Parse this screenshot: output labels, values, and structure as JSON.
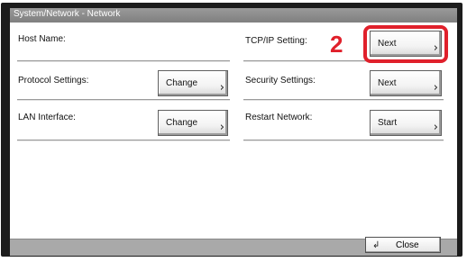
{
  "window": {
    "title": "System/Network - Network"
  },
  "left_settings": [
    {
      "label": "Host Name:",
      "button": null
    },
    {
      "label": "Protocol Settings:",
      "button": "Change"
    },
    {
      "label": "LAN Interface:",
      "button": "Change"
    }
  ],
  "right_settings": [
    {
      "label": "TCP/IP Setting:",
      "button": "Next"
    },
    {
      "label": "Security Settings:",
      "button": "Next"
    },
    {
      "label": "Restart Network:",
      "button": "Start"
    }
  ],
  "annotation": {
    "step_number": "2",
    "highlight_color": "#e0202b"
  },
  "footer": {
    "close_label": "Close"
  },
  "icons": {
    "chevron": "chevron-right-icon",
    "close": "enter-return-icon"
  }
}
